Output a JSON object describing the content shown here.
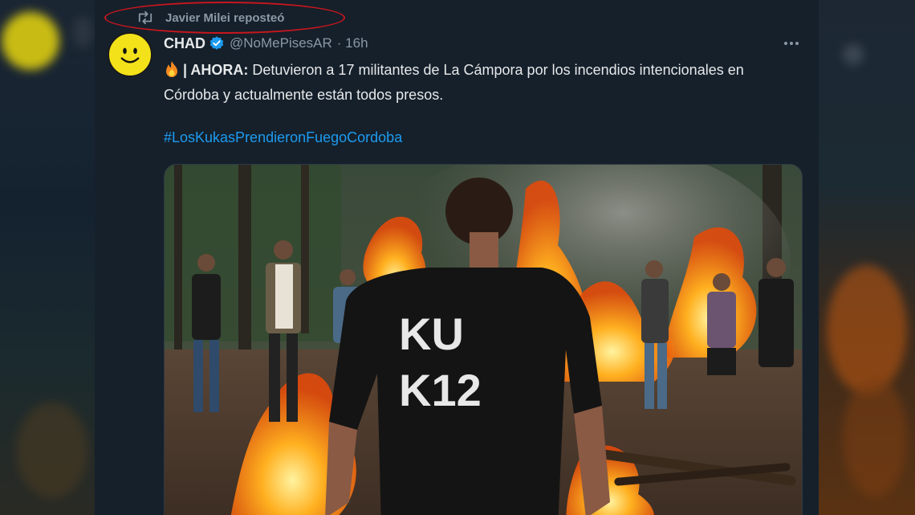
{
  "repost": {
    "text": "Javier Milei reposteó"
  },
  "author": {
    "display_name": "CHAD",
    "handle": "@NoMePisesAR",
    "time": "· 16h"
  },
  "tweet": {
    "lead": "| AHORA:",
    "body": " Detuvieron a 17 militantes de La Cámpora por los incendios intencionales en Córdoba y actualmente están todos presos.",
    "hashtag": "#LosKukasPrendieronFuegoCordoba"
  },
  "media": {
    "shirt_line1": "KU",
    "shirt_line2": "K12"
  },
  "icons": {
    "repost": "repost-icon",
    "verified": "verified-badge-icon",
    "more": "more-options-icon",
    "fire": "fire-emoji-icon",
    "avatar": "smiley-face-avatar"
  },
  "colors": {
    "background": "#15202b",
    "text": "#e7e9ea",
    "muted": "#8b98a5",
    "link": "#1d9bf0",
    "verified": "#1d9bf0",
    "annotation": "#c8161d"
  }
}
